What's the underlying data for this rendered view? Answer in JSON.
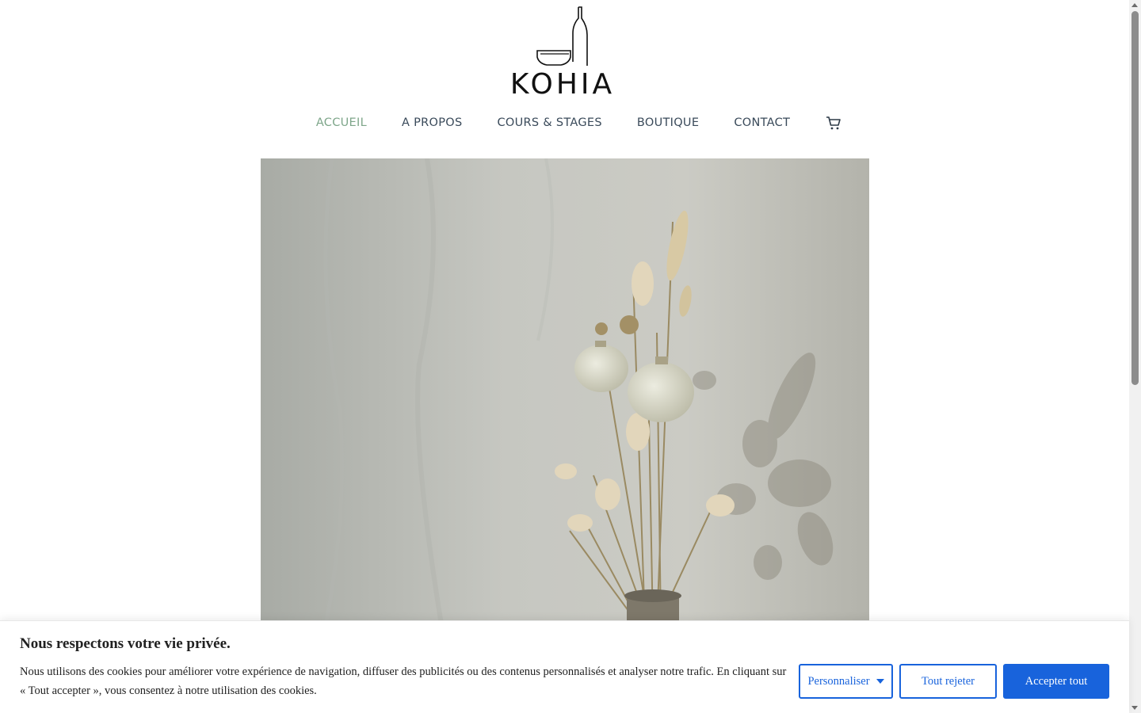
{
  "brand": {
    "name": "KOHIA"
  },
  "nav": {
    "items": [
      {
        "label": "ACCUEIL",
        "active": true
      },
      {
        "label": "A PROPOS",
        "active": false
      },
      {
        "label": "COURS & STAGES",
        "active": false
      },
      {
        "label": "BOUTIQUE",
        "active": false
      },
      {
        "label": "CONTACT",
        "active": false
      }
    ],
    "cart_icon": "shopping-cart-icon",
    "active_color": "#7ea68a",
    "text_color": "#3a4a5a"
  },
  "hero": {
    "subject": "dried-flowers-in-vase-photo"
  },
  "cookie_banner": {
    "title": "Nous respectons votre vie privée.",
    "text": "Nous utilisons des cookies pour améliorer votre expérience de navigation, diffuser des publicités ou des contenus personnalisés et analyser notre trafic. En cliquant sur « Tout accepter », vous consentez à notre utilisation des cookies.",
    "customize_label": "Personnaliser",
    "reject_label": "Tout rejeter",
    "accept_label": "Accepter tout",
    "accent_color": "#1863dc"
  }
}
